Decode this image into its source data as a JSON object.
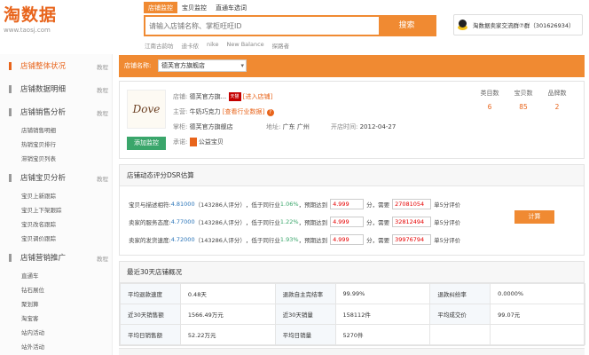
{
  "header": {
    "logo_text": "淘数据",
    "logo_url": "www.taosj.com",
    "tabs": [
      "店铺监控",
      "宝贝监控",
      "直通车选词"
    ],
    "search_placeholder": "请输入店铺名称、掌柜旺旺ID",
    "search_button": "搜索",
    "hot_keywords": [
      "江南古韵坊",
      "迪卡侬",
      "nike",
      "New Balance",
      "探路者"
    ],
    "qq_group": "淘数据卖家交流群⑦群（301626934）"
  },
  "sidebar": {
    "more_label": "教程",
    "groups": [
      {
        "title": "店铺整体状况",
        "active": true,
        "items": []
      },
      {
        "title": "店铺数据明细",
        "active": false,
        "items": []
      },
      {
        "title": "店铺销售分析",
        "active": false,
        "items": [
          "店铺销售明细",
          "热销宝贝排行",
          "滞销宝贝列表"
        ]
      },
      {
        "title": "店铺宝贝分析",
        "active": false,
        "items": [
          "宝贝上新跟踪",
          "宝贝上下架跟踪",
          "宝贝改名跟踪",
          "宝贝调价跟踪"
        ]
      },
      {
        "title": "店铺营销推广",
        "active": false,
        "items": [
          "直通车",
          "钻石展位",
          "聚划算",
          "淘宝客",
          "站内活动",
          "站外活动"
        ]
      }
    ]
  },
  "shop_bar": {
    "label": "店铺名称:",
    "selected": "德芙官方旗舰店"
  },
  "shop_info": {
    "brand_logo": "Dove",
    "add_button": "添加监控",
    "shop_label": "店铺:",
    "shop_name": "德芙官方旗...",
    "tmall_badge": "天猫",
    "enter_link": "[进入店铺]",
    "category_label": "主营:",
    "category": "牛奶巧克力",
    "industry_link": "[查看行业数据]",
    "help_mark": "?",
    "keeper_label": "掌柜:",
    "keeper": "德芙官方旗舰店",
    "location_label": "地址:",
    "location": "广东 广州",
    "opened_label": "开店时间:",
    "opened": "2012-04-27",
    "promise_label": "承诺:",
    "promise": "公益宝贝",
    "stats": [
      {
        "label": "类目数",
        "value": "6"
      },
      {
        "label": "宝贝数",
        "value": "85"
      },
      {
        "label": "品牌数",
        "value": "2"
      }
    ]
  },
  "dsr": {
    "title": "店铺动态评分DSR估算",
    "calc_button": "计算",
    "rows": [
      {
        "label": "宝贝与描述相符:",
        "score": "4.81000",
        "reviews": "（143286人评分）",
        "compare": "，低于同行业",
        "pct": "1.06%",
        "target_label": "，预期达到",
        "target": "4.999",
        "need_label": "分，需要",
        "need": "27081054",
        "tail": "单5分评价"
      },
      {
        "label": "卖家的服务态度:",
        "score": "4.77000",
        "reviews": "（143286人评分）",
        "compare": "，低于同行业",
        "pct": "1.22%",
        "target_label": "，预期达到",
        "target": "4.999",
        "need_label": "分，需要",
        "need": "32812494",
        "tail": "单5分评价"
      },
      {
        "label": "卖家的发货速度:",
        "score": "4.72000",
        "reviews": "（143286人评分）",
        "compare": "，低于同行业",
        "pct": "1.93%",
        "target_label": "，预期达到",
        "target": "4.999",
        "need_label": "分，需要",
        "need": "39976794",
        "tail": "单5分评价"
      }
    ]
  },
  "overview": {
    "title": "最近30天店铺概况",
    "rows": [
      [
        {
          "k": "平均退款速度",
          "v": "0.48天"
        },
        {
          "k": "退款自主完结率",
          "v": "99.99%"
        },
        {
          "k": "退款纠纷率",
          "v": "0.0000%"
        }
      ],
      [
        {
          "k": "近30天销售额",
          "v": "1566.49万元"
        },
        {
          "k": "近30天销量",
          "v": "158112件"
        },
        {
          "k": "平均成交价",
          "v": "99.07元"
        }
      ],
      [
        {
          "k": "平均日销售额",
          "v": "52.22万元"
        },
        {
          "k": "平均日销量",
          "v": "5270件"
        },
        {
          "k": "",
          "v": ""
        }
      ]
    ]
  }
}
